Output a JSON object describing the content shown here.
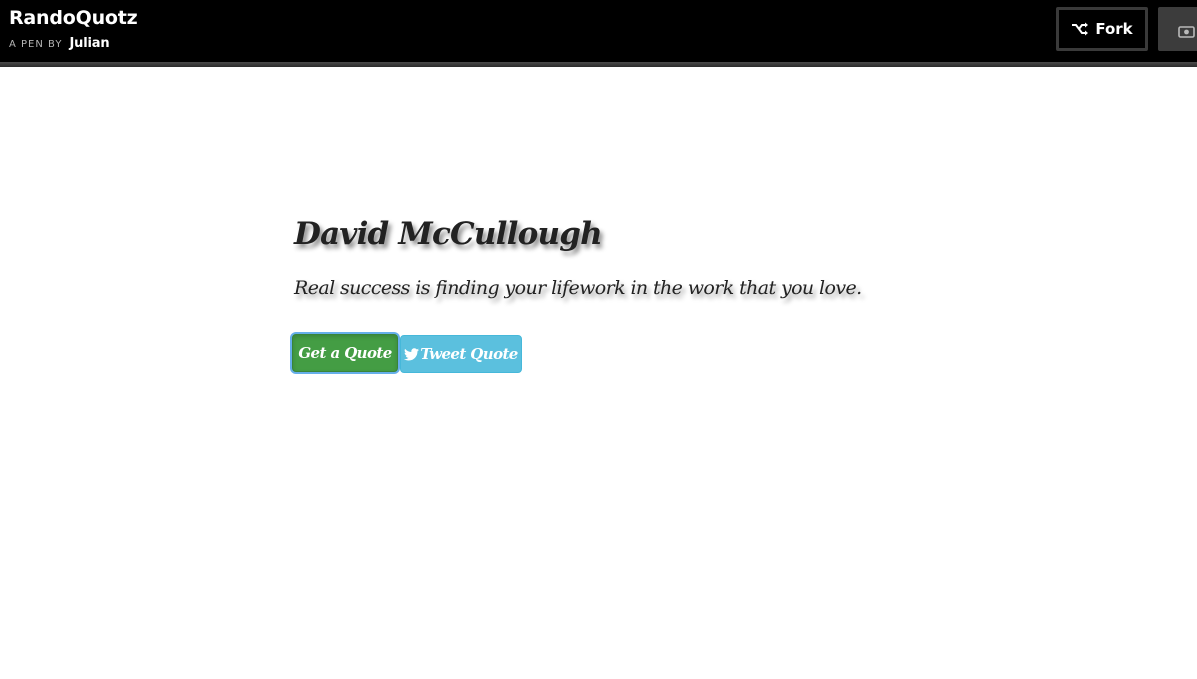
{
  "header": {
    "title": "RandoQuotz",
    "by_label": "A PEN BY",
    "author": "Julian",
    "fork_label": "Fork",
    "view_icon": "eye-icon",
    "fork_icon": "fork-icon"
  },
  "quote": {
    "author": "David McCullough",
    "text": "Real success is finding your lifework in the work that you love."
  },
  "buttons": {
    "get_quote": "Get a Quote",
    "tweet_quote": "Tweet Quote",
    "tweet_icon": "twitter-icon"
  },
  "colors": {
    "header_bg": "#000000",
    "get_quote_bg": "#449d44",
    "tweet_bg": "#5bc0de"
  }
}
